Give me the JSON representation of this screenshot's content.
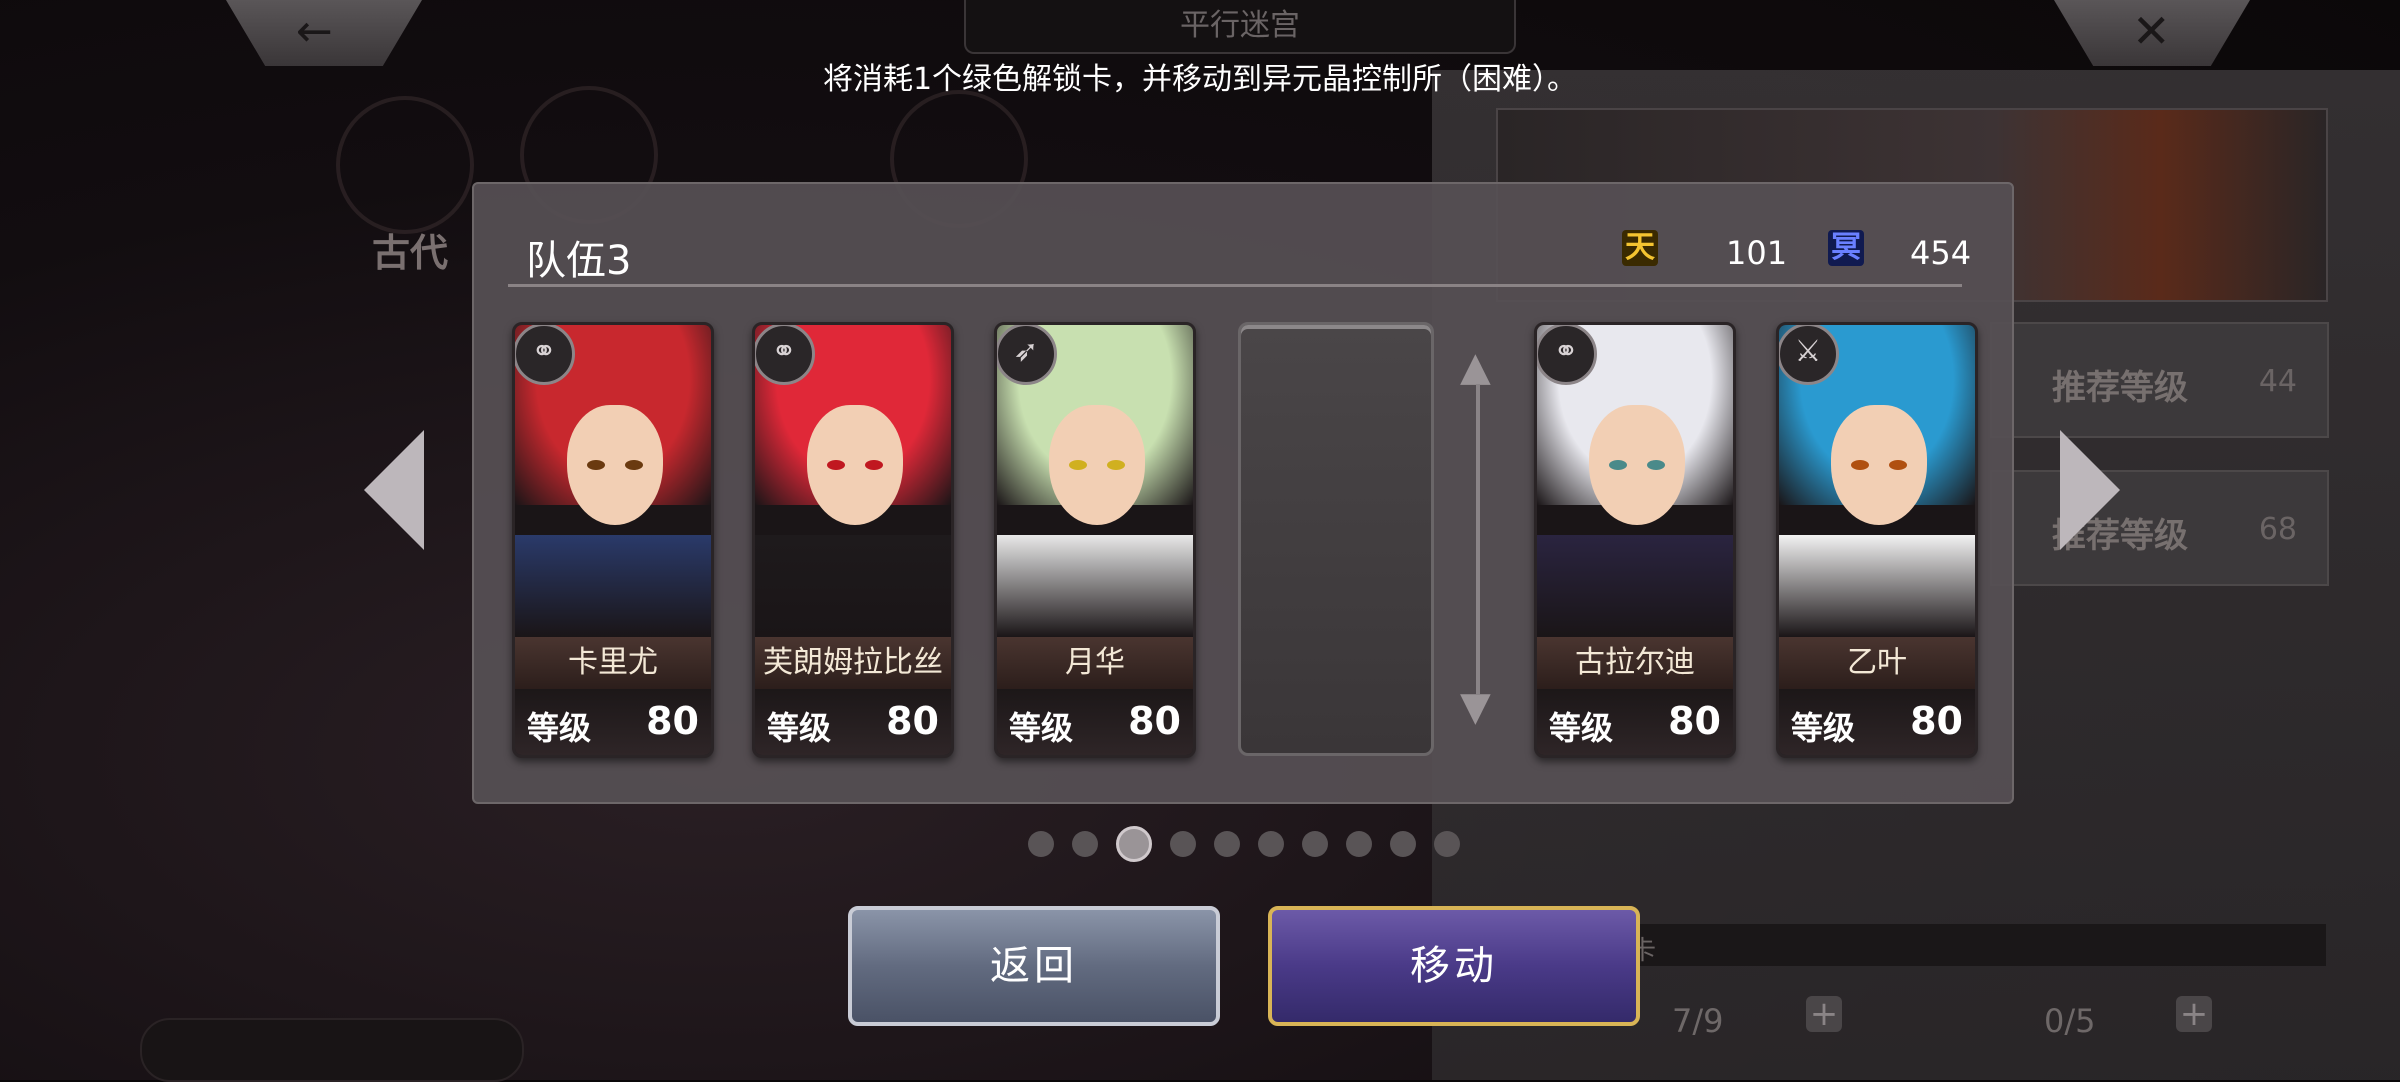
{
  "header": {
    "title": "平行迷宫",
    "notice": "将消耗1个绿色解锁卡，并移动到异元晶控制所（困难）。"
  },
  "background": {
    "tab_label": "古代",
    "recommended": [
      {
        "label": "推荐等级",
        "value": "44"
      },
      {
        "label": "推荐等级",
        "value": "68"
      }
    ],
    "bar_text": "卡",
    "counts": [
      "7/9",
      "0/5"
    ]
  },
  "team": {
    "name": "队伍3",
    "stat_gold_icon": "天",
    "stat_gold_value": "101",
    "stat_blue_icon": "冥",
    "stat_blue_value": "454",
    "level_label": "等级",
    "members": [
      {
        "name": "卡里尤",
        "level": "80",
        "class_icon": "staff-icon",
        "hair": "#c8282e",
        "cloth": "#2a3a6a",
        "eye": "#6a3a10"
      },
      {
        "name": "芙朗姆拉比丝",
        "level": "80",
        "class_icon": "staff-icon",
        "hair": "#e02838",
        "cloth": "#1e1a1c",
        "eye": "#c01820"
      },
      {
        "name": "月华",
        "level": "80",
        "class_icon": "bow-icon",
        "hair": "#c8e0b0",
        "cloth": "#e8e8e8",
        "eye": "#d0b020"
      },
      {
        "name": "古拉尔迪",
        "level": "80",
        "class_icon": "staff-icon",
        "hair": "#e8e8ee",
        "cloth": "#2a2440",
        "eye": "#4a8a8a"
      },
      {
        "name": "乙叶",
        "level": "80",
        "class_icon": "sword-icon",
        "hair": "#2a9ad0",
        "cloth": "#f2f2f2",
        "eye": "#b05010"
      }
    ],
    "page_count": 10,
    "active_page": 3
  },
  "buttons": {
    "back": "返回",
    "move": "移动"
  }
}
